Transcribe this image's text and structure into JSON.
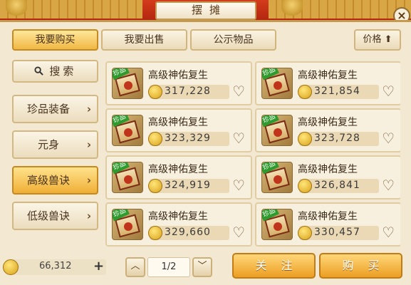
{
  "window": {
    "title": "摆摊",
    "close_label": "×"
  },
  "tabs": [
    {
      "label": "我要购买",
      "active": true
    },
    {
      "label": "我要出售",
      "active": false
    },
    {
      "label": "公示物品",
      "active": false
    }
  ],
  "sort": {
    "label": "价格",
    "arrow": "⬆"
  },
  "sidebar": {
    "search": {
      "icon": "search-icon",
      "label": "搜索"
    },
    "items": [
      {
        "label": "珍品装备",
        "active": false
      },
      {
        "label": "元身",
        "active": false
      },
      {
        "label": "高级兽诀",
        "active": true
      },
      {
        "label": "低级兽诀",
        "active": false
      }
    ]
  },
  "items": [
    {
      "name": "高级神佑复生",
      "price": "317,228",
      "rare_tag": "珍品"
    },
    {
      "name": "高级神佑复生",
      "price": "321,854",
      "rare_tag": "珍品"
    },
    {
      "name": "高级神佑复生",
      "price": "323,329",
      "rare_tag": "珍品"
    },
    {
      "name": "高级神佑复生",
      "price": "323,728",
      "rare_tag": "珍品"
    },
    {
      "name": "高级神佑复生",
      "price": "324,919",
      "rare_tag": "珍品"
    },
    {
      "name": "高级神佑复生",
      "price": "326,841",
      "rare_tag": "珍品"
    },
    {
      "name": "高级神佑复生",
      "price": "329,660",
      "rare_tag": "珍品"
    },
    {
      "name": "高级神佑复生",
      "price": "330,457",
      "rare_tag": "珍品"
    }
  ],
  "footer": {
    "money": "66,312",
    "add_label": "+",
    "prev_label": "︿",
    "next_label": "﹀",
    "page": "1/2",
    "follow_label": "关注",
    "buy_label": "购买"
  },
  "colors": {
    "accent": "#f0b844",
    "banner": "#c9311a",
    "button": "#ec9e22"
  }
}
